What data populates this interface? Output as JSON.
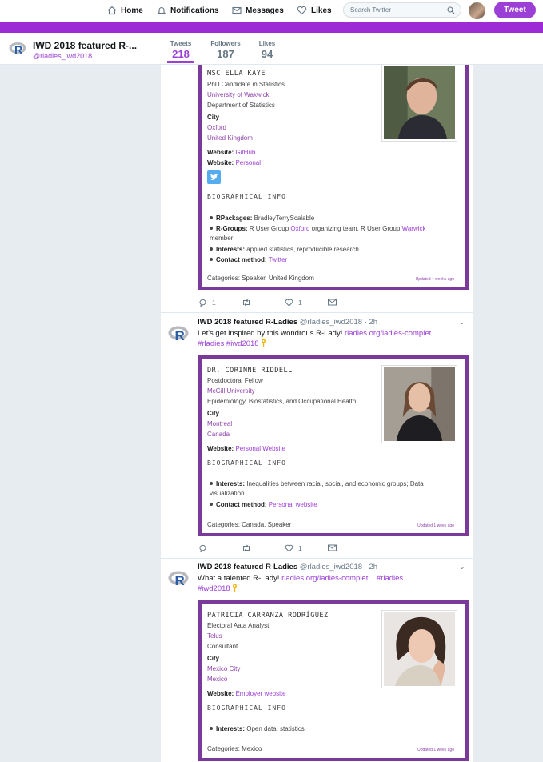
{
  "nav": {
    "home": "Home",
    "notifications": "Notifications",
    "messages": "Messages",
    "likes": "Likes",
    "search_placeholder": "Search Twitter",
    "tweet_button": "Tweet"
  },
  "profile": {
    "name": "IWD 2018 featured R-...",
    "handle": "@rladies_iwd2018",
    "stats": [
      {
        "label": "Tweets",
        "value": "218"
      },
      {
        "label": "Followers",
        "value": "187"
      },
      {
        "label": "Likes",
        "value": "94"
      }
    ]
  },
  "tweet0": {
    "card": {
      "name": "MSC ELLA KAYE",
      "title": "PhD Candidate in Statistics",
      "org": "University of Wakwick",
      "dept": "Department of Statistics",
      "city_label": "City",
      "city": "Oxford",
      "country": "United Kingdom",
      "website1_label": "Website:",
      "website1": "GitHub",
      "website2_label": "Website:",
      "website2": "Personal",
      "bio_header": "BIOGRAPHICAL INFO",
      "b1_label": "RPackages:",
      "b1_text": "BradleyTerryScalable",
      "b2_label": "R-Groups:",
      "b2_text_a": "R User Group",
      "b2_link_a": "Oxford",
      "b2_text_b": "organizing team, R User Group",
      "b2_link_b": "Warwick",
      "b2_text_c": "member",
      "b3_label": "Interests:",
      "b3_text": "applied statistics, reproducible research",
      "b4_label": "Contact method:",
      "b4_link": "Twitter",
      "categories": "Categories: Speaker, United Kingdom",
      "updated": "Updated 4 weeks ago"
    },
    "replies": "1",
    "likes": "1"
  },
  "tweet1": {
    "author": "IWD 2018 featured R-Ladies",
    "handle": "@rladies_iwd2018 · 2h",
    "text": "Let's get inspired by this wondrous R-Lady!",
    "link": "rladies.org/ladies-complet...",
    "hashtags": "#rladies #iwd2018",
    "card": {
      "name": "DR. CORINNE RIDDELL",
      "title": "Postdoctoral Fellow",
      "org": "McGill University",
      "dept": "Epidemiology, Biostatistics, and Occupational Health",
      "city_label": "City",
      "city": "Montreal",
      "country": "Canada",
      "website_label": "Website:",
      "website": "Personal Website",
      "bio_header": "BIOGRAPHICAL INFO",
      "b1_label": "Interests:",
      "b1_text": "Inequalities between racial, social, and economic groups; Data visualization",
      "b2_label": "Contact method:",
      "b2_link": "Personal website",
      "categories": "Categories: Canada, Speaker",
      "updated": "Updated 1 week ago"
    },
    "likes": "1"
  },
  "tweet2": {
    "author": "IWD 2018 featured R-Ladies",
    "handle": "@rladies_iwd2018 · 2h",
    "text": "What a talented R-Lady!",
    "link": "rladies.org/ladies-complet...",
    "hashtags_a": "#rladies",
    "hashtags_b": "#iwd2018",
    "card": {
      "name": "PATRICIA CARRANZA RODRÍGUEZ",
      "title": "Electoral Aata Analyst",
      "org": "Telus",
      "dept": "Consultant",
      "city_label": "City",
      "city": "Mexico City",
      "country": "Mexico",
      "website_label": "Website:",
      "website": "Employer website",
      "bio_header": "BIOGRAPHICAL INFO",
      "b1_label": "Interests:",
      "b1_text": "Open data, statistics",
      "categories": "Categories: Mexico",
      "updated": "Updated 1 week ago"
    }
  }
}
